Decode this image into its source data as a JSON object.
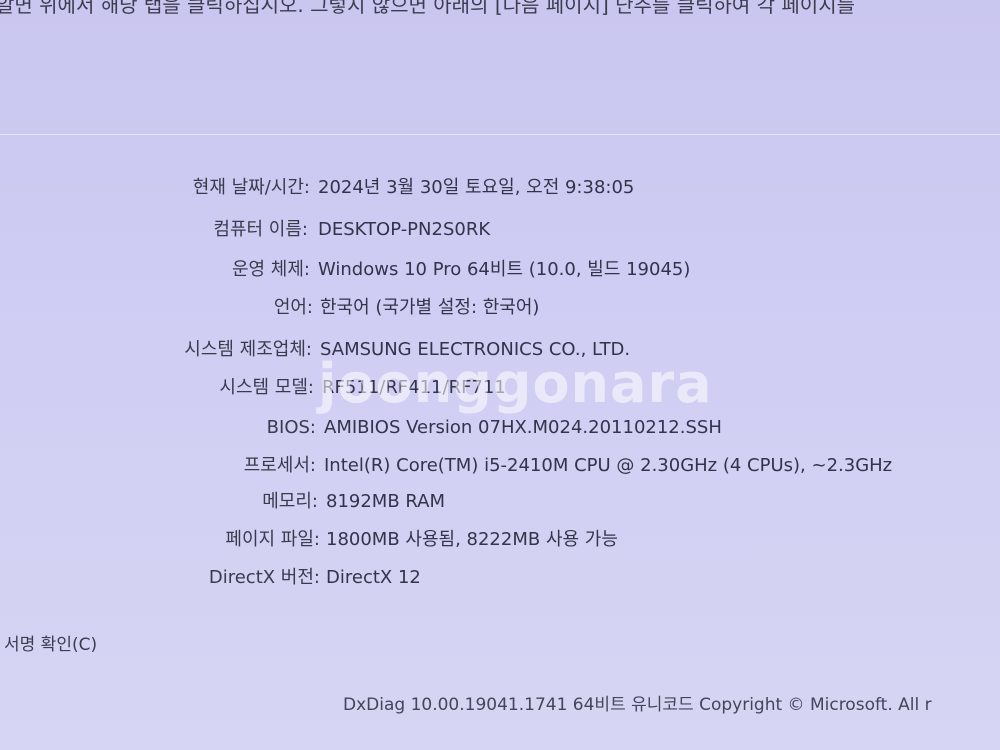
{
  "intro_text": "알면 위에서 해당 탭을 클릭하십시오. 그렇지 않으면 아래의 [다음 페이지] 단추를 클릭하여 각 페이지를",
  "system_info": [
    {
      "label": "현재 날짜/시간:",
      "value": "2024년 3월 30일 토요일, 오전 9:38:05"
    },
    {
      "label": "컴퓨터 이름:",
      "value": "DESKTOP-PN2S0RK"
    },
    {
      "label": "운영 체제:",
      "value": "Windows 10 Pro 64비트 (10.0, 빌드 19045)"
    },
    {
      "label": "언어:",
      "value": "한국어 (국가별 설정: 한국어)"
    },
    {
      "label": "시스템 제조업체:",
      "value": "SAMSUNG ELECTRONICS CO., LTD."
    },
    {
      "label": "시스템 모델:",
      "value": "RF511/RF411/RF711"
    },
    {
      "label": "BIOS:",
      "value": "AMIBIOS Version 07HX.M024.20110212.SSH"
    },
    {
      "label": "프로세서:",
      "value": "Intel(R) Core(TM) i5-2410M CPU @ 2.30GHz (4 CPUs), ~2.3GHz"
    },
    {
      "label": "메모리:",
      "value": "8192MB RAM"
    },
    {
      "label": "페이지 파일:",
      "value": "1800MB 사용됨, 8222MB 사용 가능"
    },
    {
      "label": "DirectX 버전:",
      "value": "DirectX 12"
    }
  ],
  "sign_check_label": "서명 확인(C)",
  "footer": "DxDiag 10.00.19041.1741 64비트 유니코드  Copyright © Microsoft. All r",
  "watermark": "joonggonara"
}
